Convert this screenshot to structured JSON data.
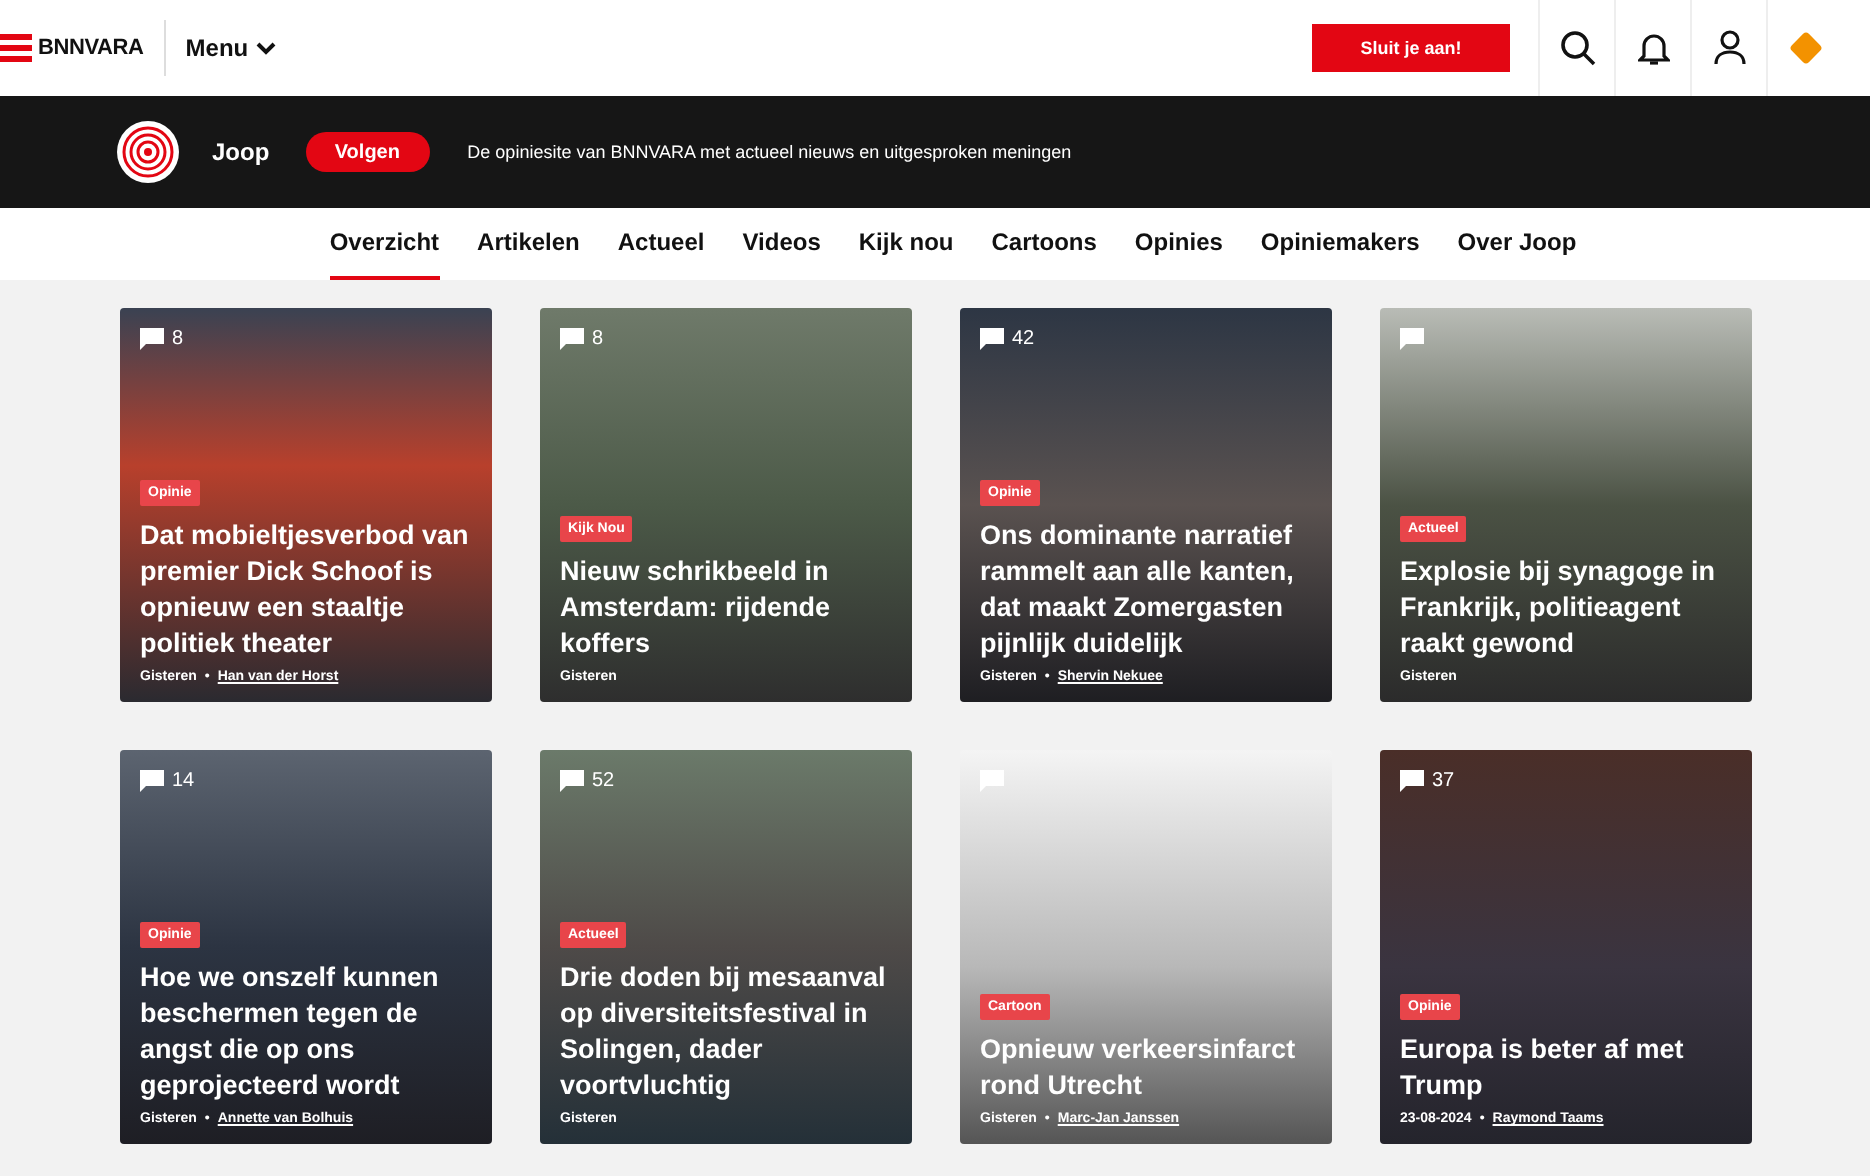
{
  "header": {
    "brand": "BNNVARA",
    "menu_label": "Menu",
    "join_button": "Sluit je aan!"
  },
  "channel_bar": {
    "name": "Joop",
    "follow_button": "Volgen",
    "tagline": "De opiniesite van BNNVARA met actueel nieuws en uitgesproken meningen"
  },
  "tabs": [
    {
      "label": "Overzicht",
      "selected": true
    },
    {
      "label": "Artikelen",
      "selected": false
    },
    {
      "label": "Actueel",
      "selected": false
    },
    {
      "label": "Videos",
      "selected": false
    },
    {
      "label": "Kijk nou",
      "selected": false
    },
    {
      "label": "Cartoons",
      "selected": false
    },
    {
      "label": "Opinies",
      "selected": false
    },
    {
      "label": "Opiniemakers",
      "selected": false
    },
    {
      "label": "Over Joop",
      "selected": false
    }
  ],
  "articles": [
    {
      "comments": "8",
      "tag": "Opinie",
      "title": "Dat mobieltjesverbod van premier Dick Schoof is opnieuw een staaltje politiek theater",
      "date": "Gisteren",
      "separator": "•",
      "author": "Han van der Horst"
    },
    {
      "comments": "8",
      "tag": "Kijk Nou",
      "title": "Nieuw schrikbeeld in Amsterdam: rijdende koffers",
      "date": "Gisteren"
    },
    {
      "comments": "42",
      "tag": "Opinie",
      "title": "Ons dominante narratief rammelt aan alle kanten, dat maakt Zomergasten pijnlijk duidelijk",
      "date": "Gisteren",
      "separator": "•",
      "author": "Shervin Nekuee"
    },
    {
      "tag": "Actueel",
      "title": "Explosie bij synagoge in Frankrijk, politieagent raakt gewond",
      "date": "Gisteren"
    },
    {
      "comments": "14",
      "tag": "Opinie",
      "title": "Hoe we onszelf kunnen beschermen tegen de angst die op ons geprojecteerd wordt",
      "date": "Gisteren",
      "separator": "•",
      "author": "Annette van Bolhuis"
    },
    {
      "comments": "52",
      "tag": "Actueel",
      "title": "Drie doden bij mesaanval op diversiteitsfestival in Solingen, dader voortvluchtig",
      "date": "Gisteren"
    },
    {
      "tag": "Cartoon",
      "title": "Opnieuw verkeersinfarct rond Utrecht",
      "date": "Gisteren",
      "separator": "•",
      "author": "Marc-Jan Janssen"
    },
    {
      "comments": "37",
      "tag": "Opinie",
      "title": "Europa is beter af met Trump",
      "date": "23-08-2024",
      "separator": "•",
      "author": "Raymond Taams"
    }
  ]
}
